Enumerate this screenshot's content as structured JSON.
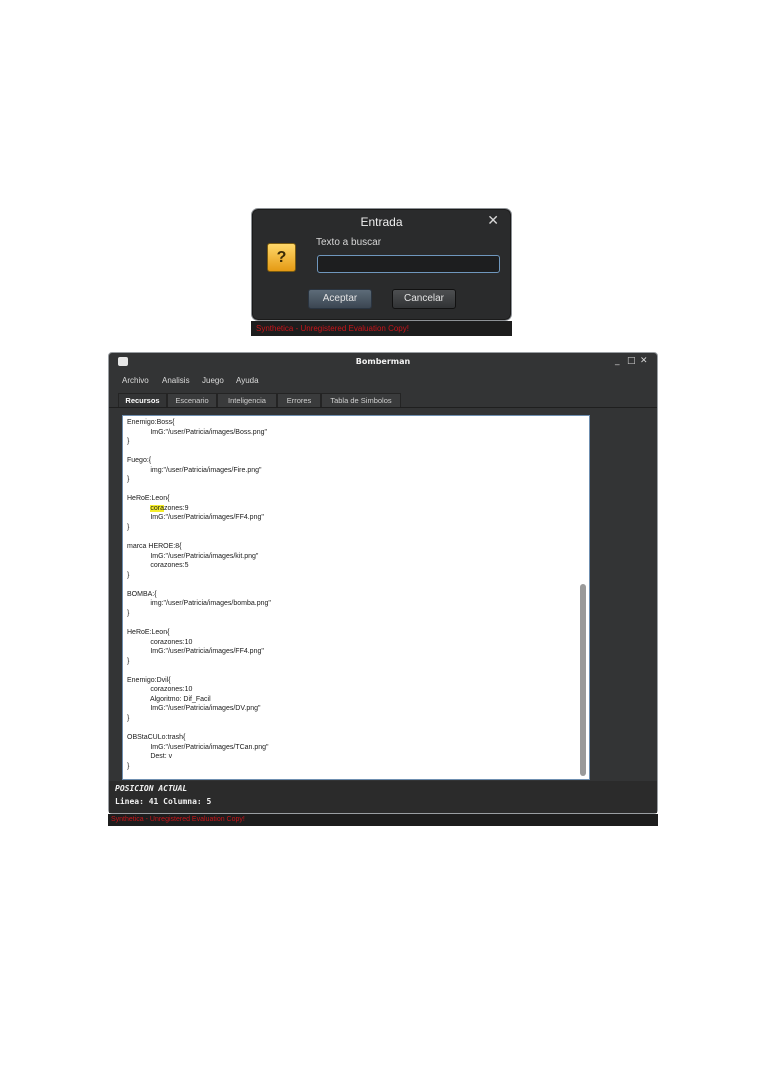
{
  "dialog": {
    "title": "Entrada",
    "close_glyph": "✕",
    "icon": "question-icon",
    "icon_glyph": "?",
    "prompt": "Texto a buscar",
    "input_value": "",
    "ok_label": "Aceptar",
    "cancel_label": "Cancelar",
    "watermark": "Synthetica - Unregistered Evaluation Copy!"
  },
  "window": {
    "title": "Bomberman",
    "controls": {
      "minimize": "_",
      "maximize": "□",
      "close": "✕"
    },
    "menu": [
      "Archivo",
      "Analisis",
      "Juego",
      "Ayuda"
    ],
    "tabs": [
      "Recursos",
      "Escenario",
      "Inteligencia",
      "Errores",
      "Tabla de Simbolos"
    ],
    "active_tab": "Recursos",
    "editor": {
      "highlight": "cora",
      "lines": [
        "Enemigo:Boss{",
        "\t\tImG:\"/user/Patricia/images/Boss.png\"",
        "}",
        "",
        "Fuego:{",
        "\t\timg:\"/user/Patricia/images/Fire.png\"",
        "}",
        "",
        "HeRoE:Leon{",
        "\t\tcorazones:9",
        "\t\tImG:\"/user/Patricia/images/FF4.png\"",
        "}",
        "",
        "marca HEROE:8{",
        "\t\tImG:\"/user/Patricia/images/kit.png\"",
        "\t\tcorazones:5",
        "}",
        "",
        "BOMBA:{",
        "\t\timg:\"/user/Patricia/images/bomba.png\"",
        "}",
        "",
        "HeRoE:Leon{",
        "\t\tcorazones:10",
        "\t\tImG:\"/user/Patricia/images/FF4.png\"",
        "}",
        "",
        "Enemigo:Dvil{",
        "\t\tcorazones:10",
        "\t\tAlgoritmo: Dif_Facil",
        "\t\tImG:\"/user/Patricia/images/DV.png\"",
        "}",
        "",
        "OBStaCULo:trash{",
        "\t\tImG:\"/user/Patricia/images/TCan.png\"",
        "\t\tDest: v",
        "}"
      ]
    },
    "status": {
      "title": "POSICION ACTUAL",
      "position": "Linea: 41 Columna: 5"
    },
    "watermark": "Synthetica - Unregistered Evaluation Copy!"
  }
}
